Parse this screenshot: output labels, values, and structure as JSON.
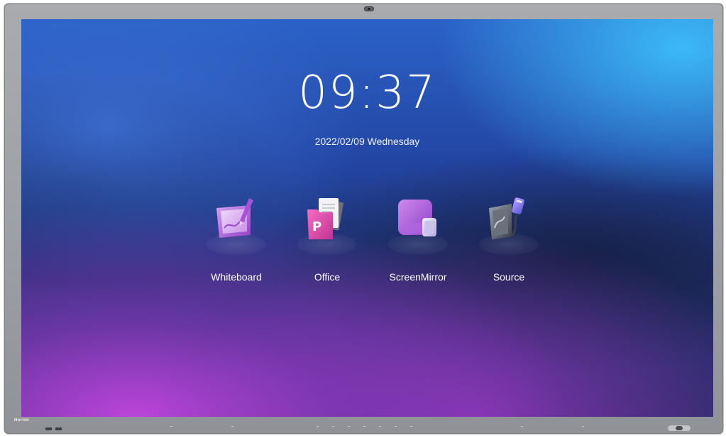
{
  "device": {
    "brand": "Horion"
  },
  "home": {
    "time": "09:37",
    "date": "2022/02/09 Wednesday"
  },
  "apps": [
    {
      "label": "Whiteboard",
      "icon": "whiteboard-icon"
    },
    {
      "label": "Office",
      "icon": "office-icon"
    },
    {
      "label": "ScreenMirror",
      "icon": "screen-mirror-icon"
    },
    {
      "label": "Source",
      "icon": "source-icon"
    }
  ],
  "colors": {
    "wallpaper_blue": "#2b62c7",
    "wallpaper_purple": "#c446e1",
    "wallpaper_cyan": "#3cbefa",
    "bezel": "#9ea1a5"
  }
}
